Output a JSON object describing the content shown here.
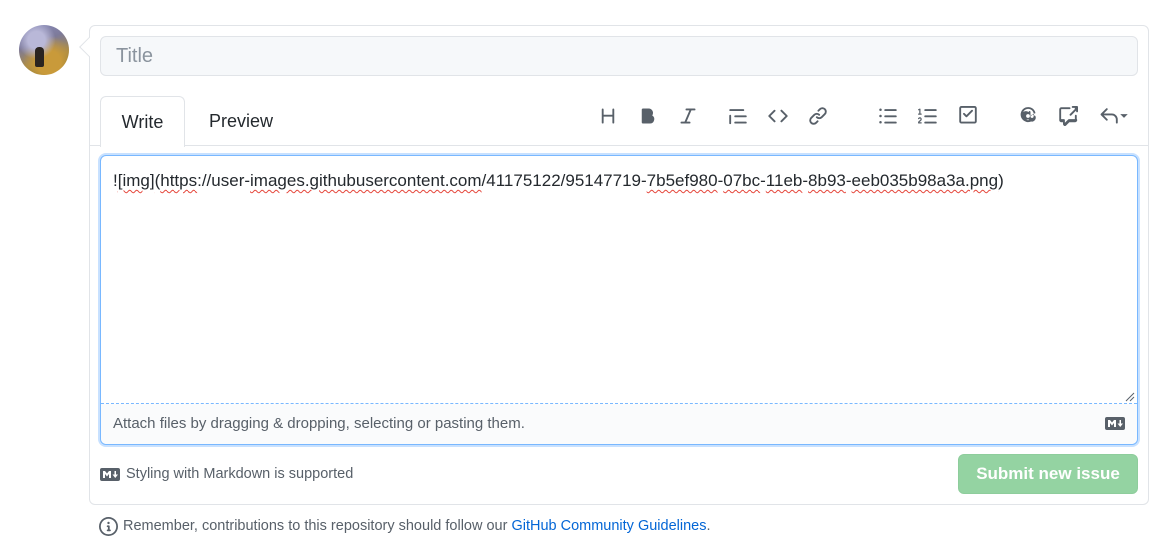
{
  "form": {
    "title_placeholder": "Title",
    "title_value": ""
  },
  "tabs": {
    "write": "Write",
    "preview": "Preview"
  },
  "toolbar": {
    "icons": [
      "heading-icon",
      "bold-icon",
      "italic-icon",
      "quote-icon",
      "code-icon",
      "link-icon",
      "unordered-list-icon",
      "ordered-list-icon",
      "task-list-icon",
      "mention-icon",
      "reference-icon",
      "reply-icon"
    ]
  },
  "editor": {
    "prefix": "!",
    "link_text": "[img]",
    "open_paren": "(",
    "url_parts": [
      {
        "t": "https",
        "sq": true
      },
      {
        "t": "://user-",
        "sq": false
      },
      {
        "t": "images.githubusercontent.com",
        "sq": true
      },
      {
        "t": "/41175122/95147719-",
        "sq": false
      },
      {
        "t": "7b5ef980",
        "sq": true
      },
      {
        "t": "-",
        "sq": false
      },
      {
        "t": "07bc",
        "sq": true
      },
      {
        "t": "-",
        "sq": false
      },
      {
        "t": "11eb",
        "sq": true
      },
      {
        "t": "-",
        "sq": false
      },
      {
        "t": "8b93",
        "sq": true
      },
      {
        "t": "-",
        "sq": false
      },
      {
        "t": "eeb035b98a3a.png",
        "sq": true
      }
    ],
    "close_paren": ")",
    "attach_hint": "Attach files by dragging & dropping, selecting or pasting them."
  },
  "footer": {
    "markdown_note": "Styling with Markdown is supported",
    "submit_label": "Submit new issue",
    "remember_text": "Remember, contributions to this repository should follow our",
    "guidelines_link": "GitHub Community Guidelines",
    "period": "."
  },
  "colors": {
    "accent_blue": "#0366d6",
    "focus_border": "#79b8ff",
    "submit_disabled": "#94d3a2",
    "icon_gray": "#586069"
  }
}
